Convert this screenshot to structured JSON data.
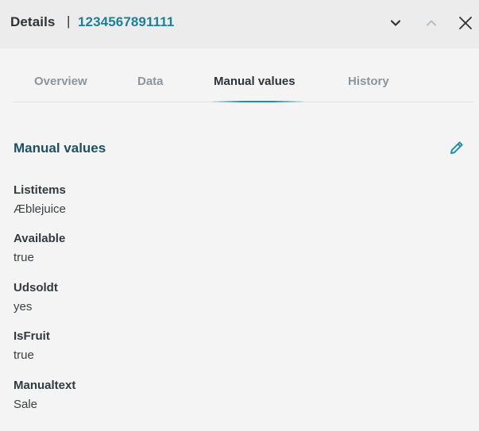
{
  "header": {
    "title": "Details",
    "separator": "|",
    "record_id": "1234567891111",
    "icons": {
      "next": "chevron-down-icon",
      "previous": "chevron-up-icon",
      "close": "close-icon"
    }
  },
  "tabs": [
    {
      "label": "Overview",
      "active": false
    },
    {
      "label": "Data",
      "active": false
    },
    {
      "label": "Manual values",
      "active": true
    },
    {
      "label": "History",
      "active": false
    }
  ],
  "section": {
    "title": "Manual values",
    "edit_icon": "pencil-icon",
    "fields": [
      {
        "label": "Listitems",
        "value": "Æblejuice"
      },
      {
        "label": "Available",
        "value": "true"
      },
      {
        "label": "Udsoldt",
        "value": "yes"
      },
      {
        "label": "IsFruit",
        "value": "true"
      },
      {
        "label": "Manualtext",
        "value": "Sale"
      }
    ]
  },
  "colors": {
    "accent": "#1f8fa7",
    "record_id": "#1e7f98",
    "section_title": "#1f4f63",
    "header_bg": "#ececec",
    "body_bg": "#f4f4f4"
  }
}
